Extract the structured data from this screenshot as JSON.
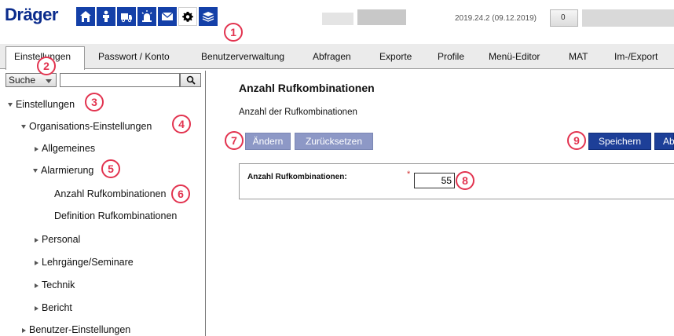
{
  "brand": {
    "name": "Dräger",
    "color": "#0a2b8c"
  },
  "toolbar": {
    "icons": [
      {
        "name": "home-icon"
      },
      {
        "name": "person-icon"
      },
      {
        "name": "vehicle-icon"
      },
      {
        "name": "alarm-light-icon"
      },
      {
        "name": "mail-icon"
      },
      {
        "name": "settings-gear-icon",
        "active": true
      },
      {
        "name": "layers-icon"
      }
    ],
    "accent_color": "#1440a8"
  },
  "header": {
    "version": "2019.24.2 (09.12.2019)",
    "mail_count": "0"
  },
  "menu": {
    "items": [
      "Einstellungen",
      "Passwort / Konto",
      "Benutzerverwaltung",
      "Abfragen",
      "Exporte",
      "Profile",
      "Menü-Editor",
      "MAT",
      "Im-/Export"
    ],
    "active": "Einstellungen"
  },
  "search": {
    "mode": "Suche",
    "value": "",
    "button_icon": "search-icon"
  },
  "tree": [
    {
      "label": "Einstellungen",
      "expanded": true
    },
    {
      "label": "Organisations-Einstellungen",
      "expanded": true
    },
    {
      "label": "Allgemeines",
      "expanded": false
    },
    {
      "label": "Alarmierung",
      "expanded": true
    },
    {
      "label": "Anzahl Rufkombinationen",
      "selected": true
    },
    {
      "label": "Definition Rufkombinationen"
    },
    {
      "label": "Personal",
      "expanded": false
    },
    {
      "label": "Lehrgänge/Seminare",
      "expanded": false
    },
    {
      "label": "Technik",
      "expanded": false
    },
    {
      "label": "Bericht",
      "expanded": false
    },
    {
      "label": "Benutzer-Einstellungen",
      "expanded": false
    }
  ],
  "main": {
    "title": "Anzahl Rufkombinationen",
    "subtitle": "Anzahl der Rufkombinationen",
    "buttons": {
      "change": "Ändern",
      "reset": "Zurücksetzen",
      "save": "Speichern",
      "cancel_partial": "Ab"
    },
    "form": {
      "label": "Anzahl Rufkombinationen:",
      "required_marker": "*",
      "value": "55"
    }
  },
  "annotations": [
    "1",
    "2",
    "3",
    "4",
    "5",
    "6",
    "7",
    "8",
    "9"
  ],
  "colors": {
    "annotation": "#e2334f",
    "button_primary": "#1d3f98",
    "button_disabled": "#8d98c6"
  }
}
